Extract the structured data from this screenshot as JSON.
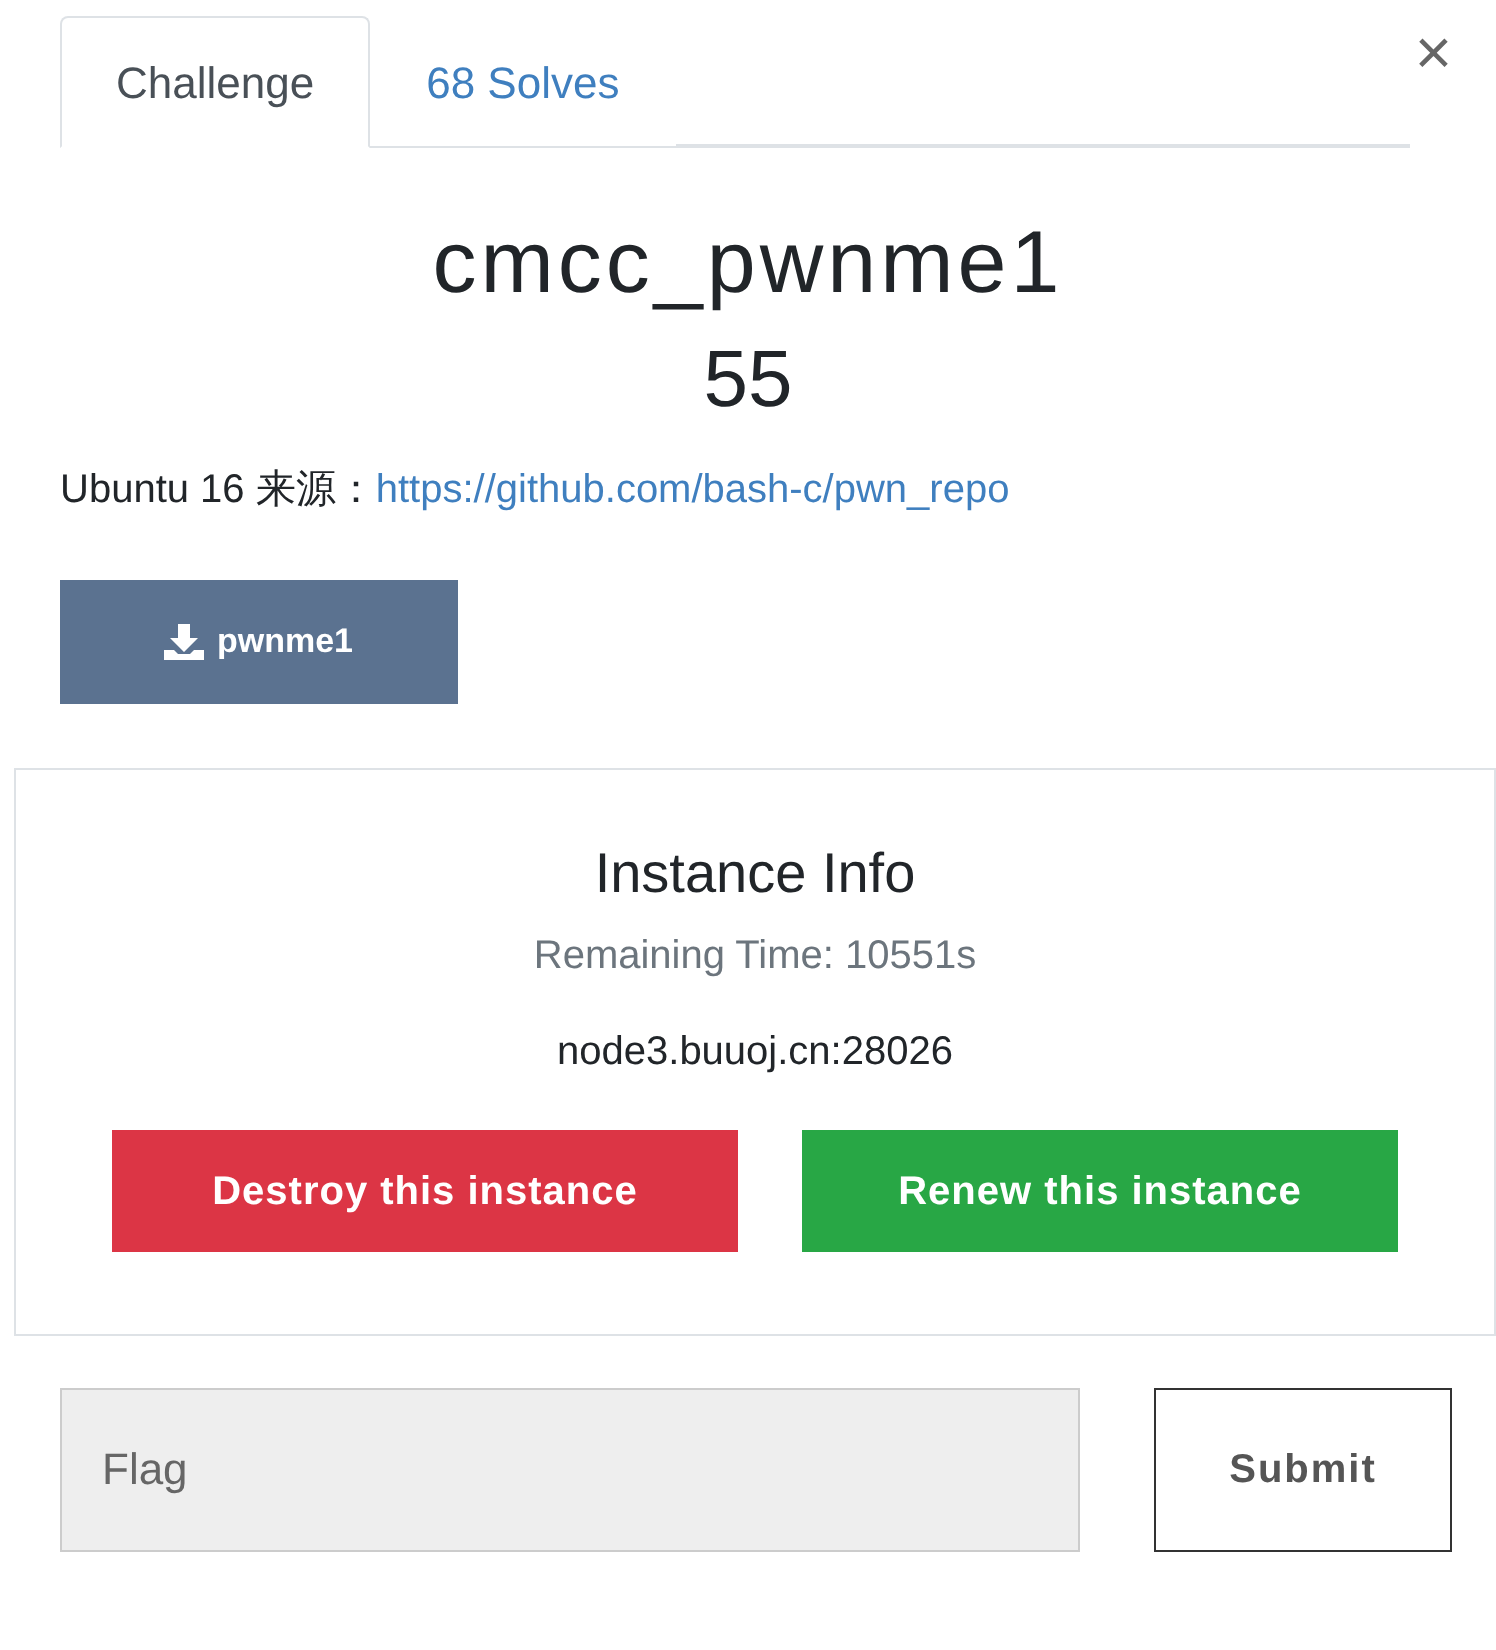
{
  "tabs": [
    {
      "label": "Challenge",
      "selected": true
    },
    {
      "label": "68 Solves",
      "selected": false
    }
  ],
  "close": "×",
  "challenge": {
    "name": "cmcc_pwnme1",
    "value": "55",
    "description": "Ubuntu 16 来源：",
    "link": "https://github.com/bash-c/pwn_repo"
  },
  "files": [
    {
      "label": "pwnme1"
    }
  ],
  "instance": {
    "title": "Instance Info",
    "remaining": "Remaining Time: 10551s",
    "host": "node3.buuoj.cn:28026",
    "buttons": [
      {
        "label": "Destroy this instance",
        "kind": "danger"
      },
      {
        "label": "Renew this instance",
        "kind": "success"
      }
    ]
  },
  "flag": {
    "placeholder": "Flag",
    "submit": "Submit"
  }
}
